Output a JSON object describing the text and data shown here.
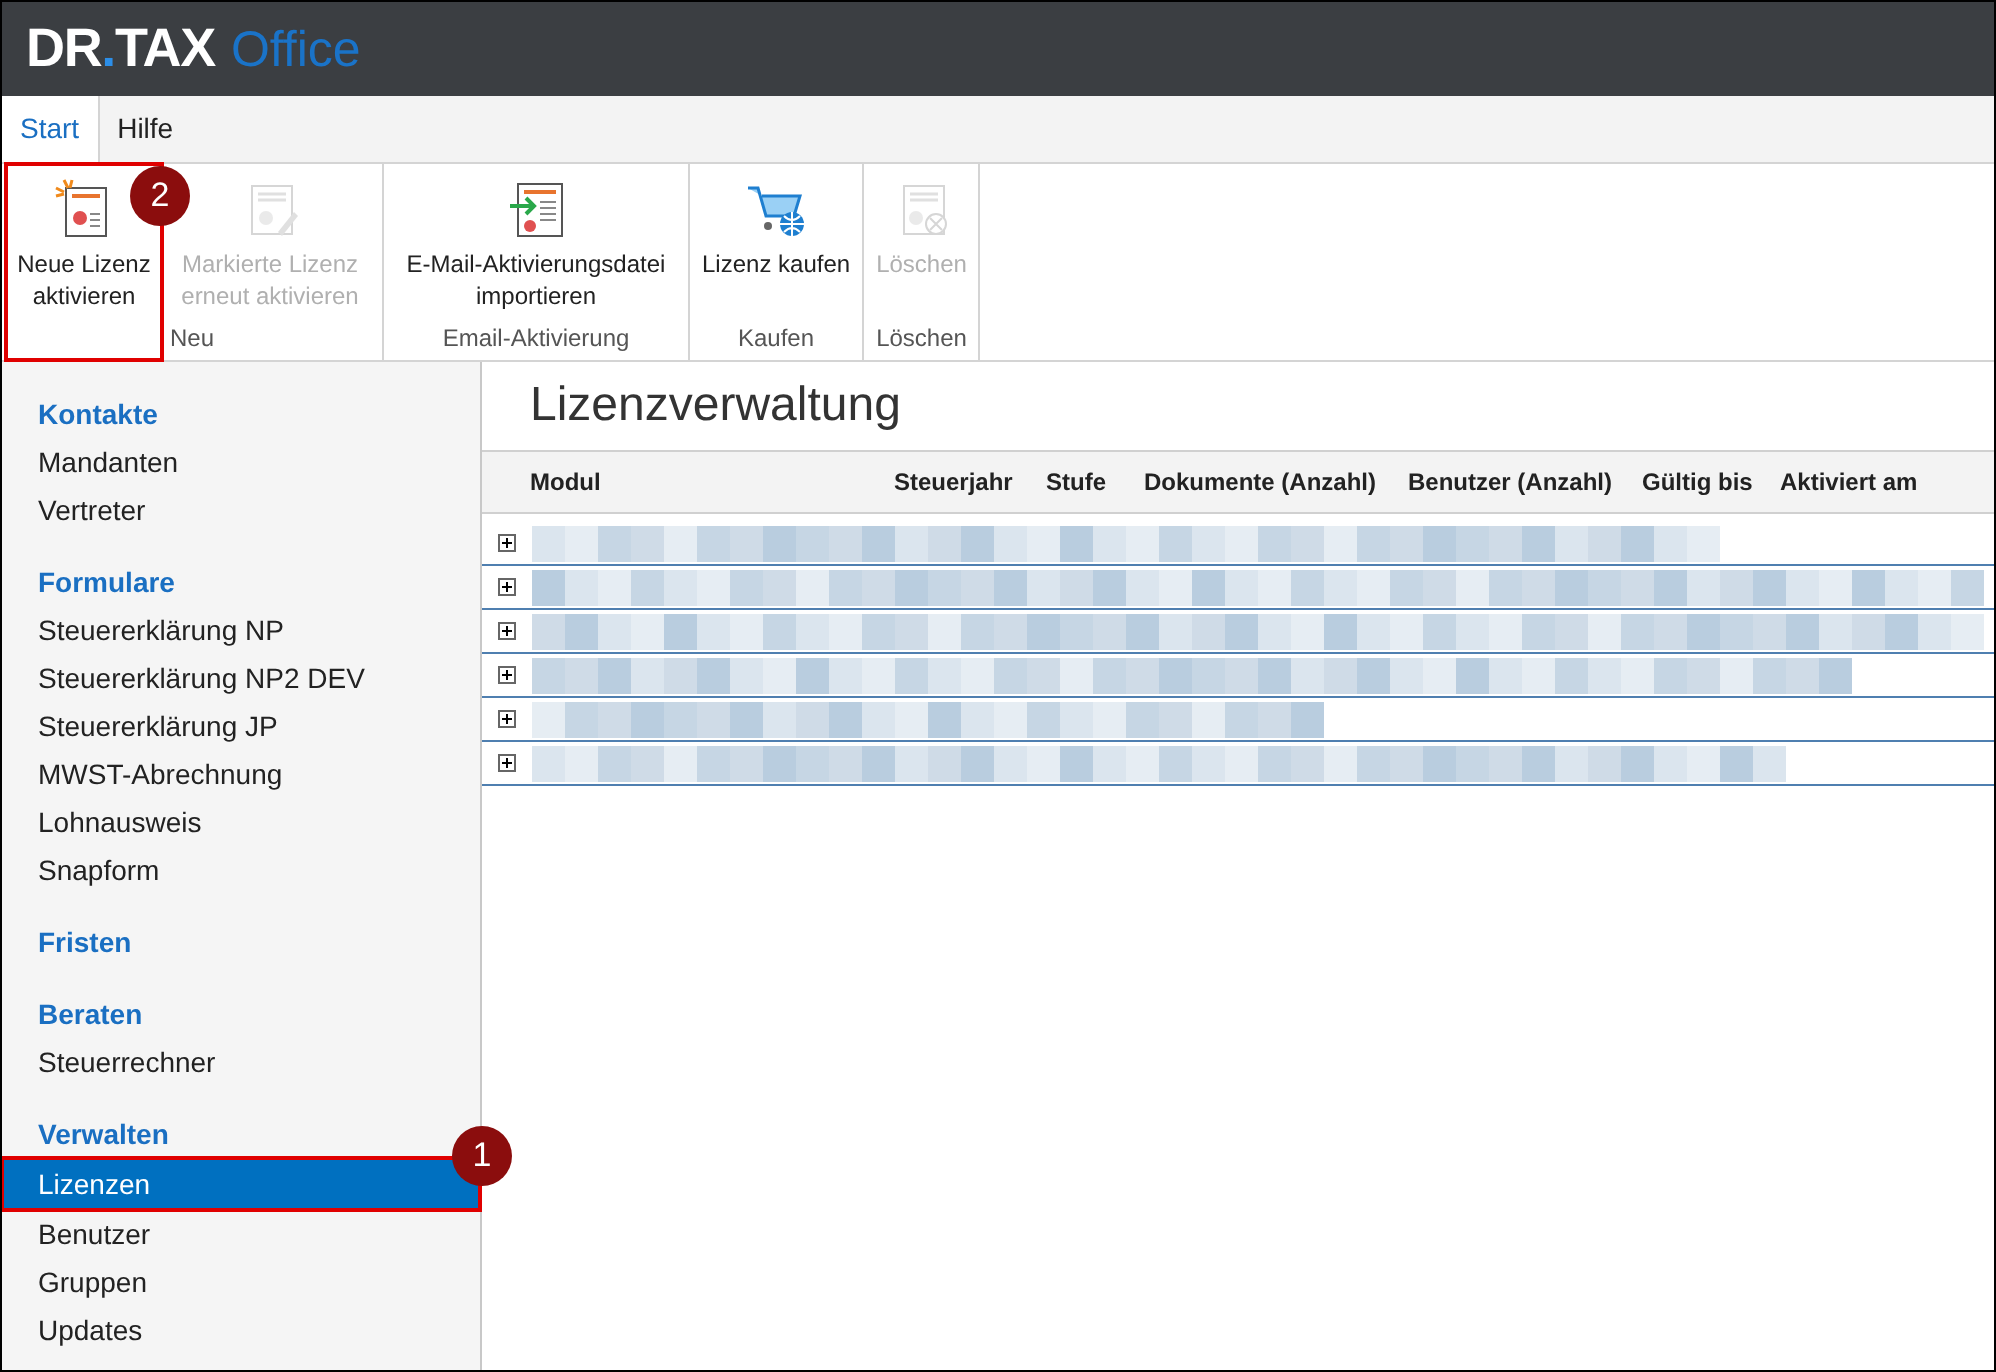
{
  "logo": {
    "prefix": "DR",
    "dot": ".",
    "suffix": "TAX",
    "product": "Office"
  },
  "tabs": [
    {
      "label": "Start",
      "selected": true
    },
    {
      "label": "Hilfe",
      "selected": false
    }
  ],
  "ribbon": {
    "groups": [
      {
        "label": "Neu",
        "buttons": [
          {
            "kind": "new",
            "label": "Neue Lizenz aktivieren",
            "disabled": false,
            "callout": "2"
          },
          {
            "kind": "renew",
            "label": "Markierte Lizenz erneut aktivieren",
            "disabled": true
          }
        ]
      },
      {
        "label": "Email-Aktivierung",
        "buttons": [
          {
            "kind": "import",
            "label": "E-Mail-Aktivierungsdatei importieren",
            "disabled": false
          }
        ]
      },
      {
        "label": "Kaufen",
        "buttons": [
          {
            "kind": "buy",
            "label": "Lizenz kaufen",
            "disabled": false
          }
        ]
      },
      {
        "label": "Löschen",
        "buttons": [
          {
            "kind": "delete",
            "label": "Löschen",
            "disabled": true
          }
        ]
      }
    ]
  },
  "sidebar": {
    "sections": [
      {
        "title": "Kontakte",
        "items": [
          {
            "label": "Mandanten",
            "selected": false
          },
          {
            "label": "Vertreter",
            "selected": false
          }
        ]
      },
      {
        "title": "Formulare",
        "items": [
          {
            "label": "Steuererklärung NP",
            "selected": false
          },
          {
            "label": "Steuererklärung NP2 DEV",
            "selected": false
          },
          {
            "label": "Steuererklärung JP",
            "selected": false
          },
          {
            "label": "MWST-Abrechnung",
            "selected": false
          },
          {
            "label": "Lohnausweis",
            "selected": false
          },
          {
            "label": "Snapform",
            "selected": false
          }
        ]
      },
      {
        "title": "Fristen"
      },
      {
        "title": "Beraten",
        "items": [
          {
            "label": "Steuerrechner",
            "selected": false
          }
        ]
      },
      {
        "title": "Verwalten",
        "items": [
          {
            "label": "Lizenzen",
            "selected": true,
            "callout": "1"
          },
          {
            "label": "Benutzer",
            "selected": false
          },
          {
            "label": "Gruppen",
            "selected": false
          },
          {
            "label": "Updates",
            "selected": false
          }
        ]
      }
    ]
  },
  "main": {
    "title": "Lizenzverwaltung",
    "table": {
      "columns": [
        "Modul",
        "Steuerjahr",
        "Stufe",
        "Dokumente (Anzahl)",
        "Benutzer (Anzahl)",
        "Gültig bis",
        "Aktiviert am"
      ],
      "rows": [
        {
          "expanded": false
        },
        {
          "expanded": false
        },
        {
          "expanded": false
        },
        {
          "expanded": false
        },
        {
          "expanded": false
        },
        {
          "expanded": false
        }
      ]
    }
  }
}
